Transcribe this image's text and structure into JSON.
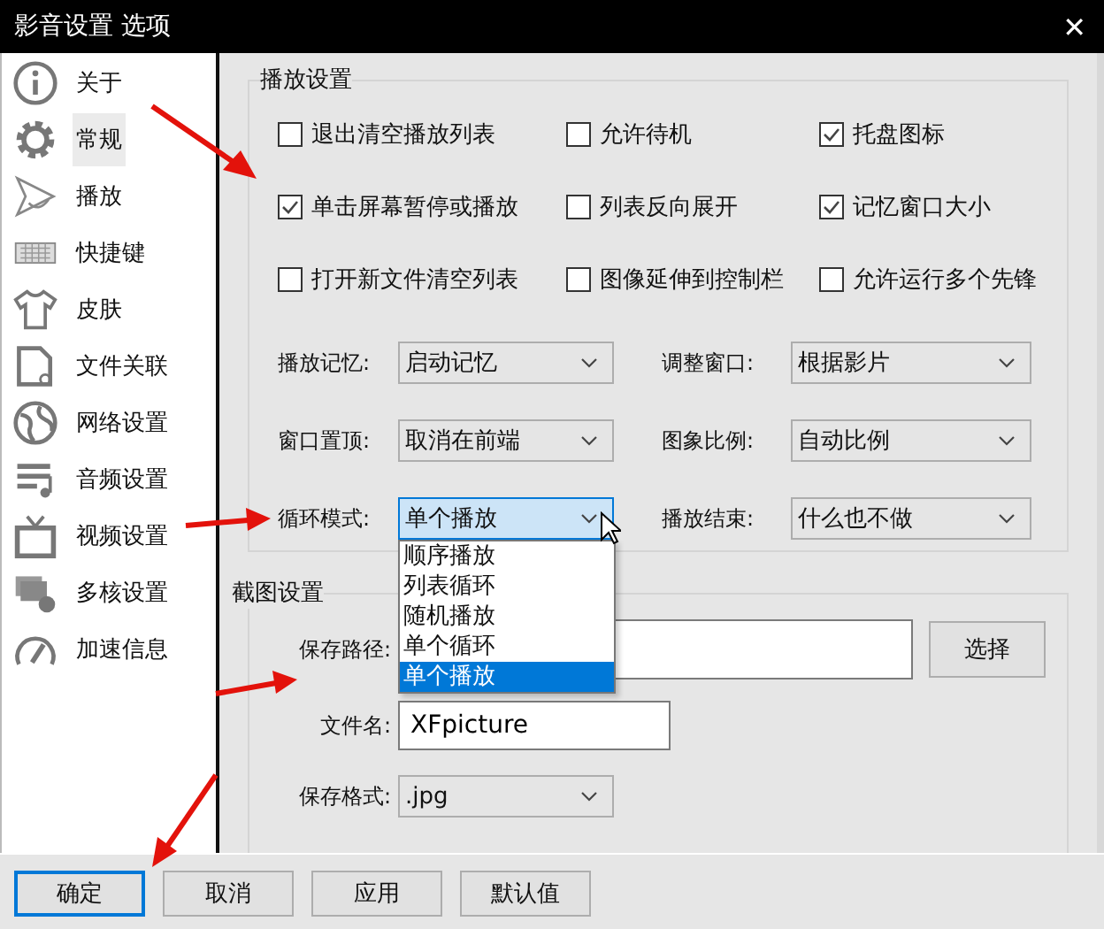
{
  "window": {
    "title": "影音设置 选项",
    "close": "✕"
  },
  "sidebar": {
    "items": [
      {
        "label": "关于",
        "selected": false
      },
      {
        "label": "常规",
        "selected": true
      },
      {
        "label": "播放",
        "selected": false
      },
      {
        "label": "快捷键",
        "selected": false
      },
      {
        "label": "皮肤",
        "selected": false
      },
      {
        "label": "文件关联",
        "selected": false
      },
      {
        "label": "网络设置",
        "selected": false
      },
      {
        "label": "音频设置",
        "selected": false
      },
      {
        "label": "视频设置",
        "selected": false
      },
      {
        "label": "多核设置",
        "selected": false
      },
      {
        "label": "加速信息",
        "selected": false
      }
    ]
  },
  "playback_group": {
    "title": "播放设置",
    "checkboxes": [
      {
        "label": "退出清空播放列表",
        "checked": false
      },
      {
        "label": "允许待机",
        "checked": false
      },
      {
        "label": "托盘图标",
        "checked": true
      },
      {
        "label": "单击屏幕暂停或播放",
        "checked": true
      },
      {
        "label": "列表反向展开",
        "checked": false
      },
      {
        "label": "记忆窗口大小",
        "checked": true
      },
      {
        "label": "打开新文件清空列表",
        "checked": false
      },
      {
        "label": "图像延伸到控制栏",
        "checked": false
      },
      {
        "label": "允许运行多个先锋",
        "checked": false
      }
    ],
    "selects": [
      {
        "label": "播放记忆:",
        "value": "启动记忆",
        "expanded": false
      },
      {
        "label": "调整窗口:",
        "value": "根据影片",
        "expanded": false
      },
      {
        "label": "窗口置顶:",
        "value": "取消在前端",
        "expanded": false
      },
      {
        "label": "图象比例:",
        "value": "自动比例",
        "expanded": false
      },
      {
        "label": "循环模式:",
        "value": "单个播放",
        "expanded": true,
        "options": [
          {
            "label": "顺序播放",
            "selected": false
          },
          {
            "label": "列表循环",
            "selected": false
          },
          {
            "label": "随机播放",
            "selected": false
          },
          {
            "label": "单个循环",
            "selected": false
          },
          {
            "label": "单个播放",
            "selected": true
          }
        ]
      },
      {
        "label": "播放结束:",
        "value": "什么也不做",
        "expanded": false
      }
    ]
  },
  "screenshot_group": {
    "title": "截图设置",
    "fields": [
      {
        "kind": "path",
        "label": "保存路径:",
        "button": "选择"
      },
      {
        "kind": "text",
        "label": "文件名:",
        "value": "XFpicture"
      },
      {
        "kind": "select",
        "label": "保存格式:",
        "value": ".jpg"
      }
    ]
  },
  "buttons": [
    {
      "label": "确定",
      "focused": true
    },
    {
      "label": "取消",
      "focused": false
    },
    {
      "label": "应用",
      "focused": false
    },
    {
      "label": "默认值",
      "focused": false
    }
  ]
}
